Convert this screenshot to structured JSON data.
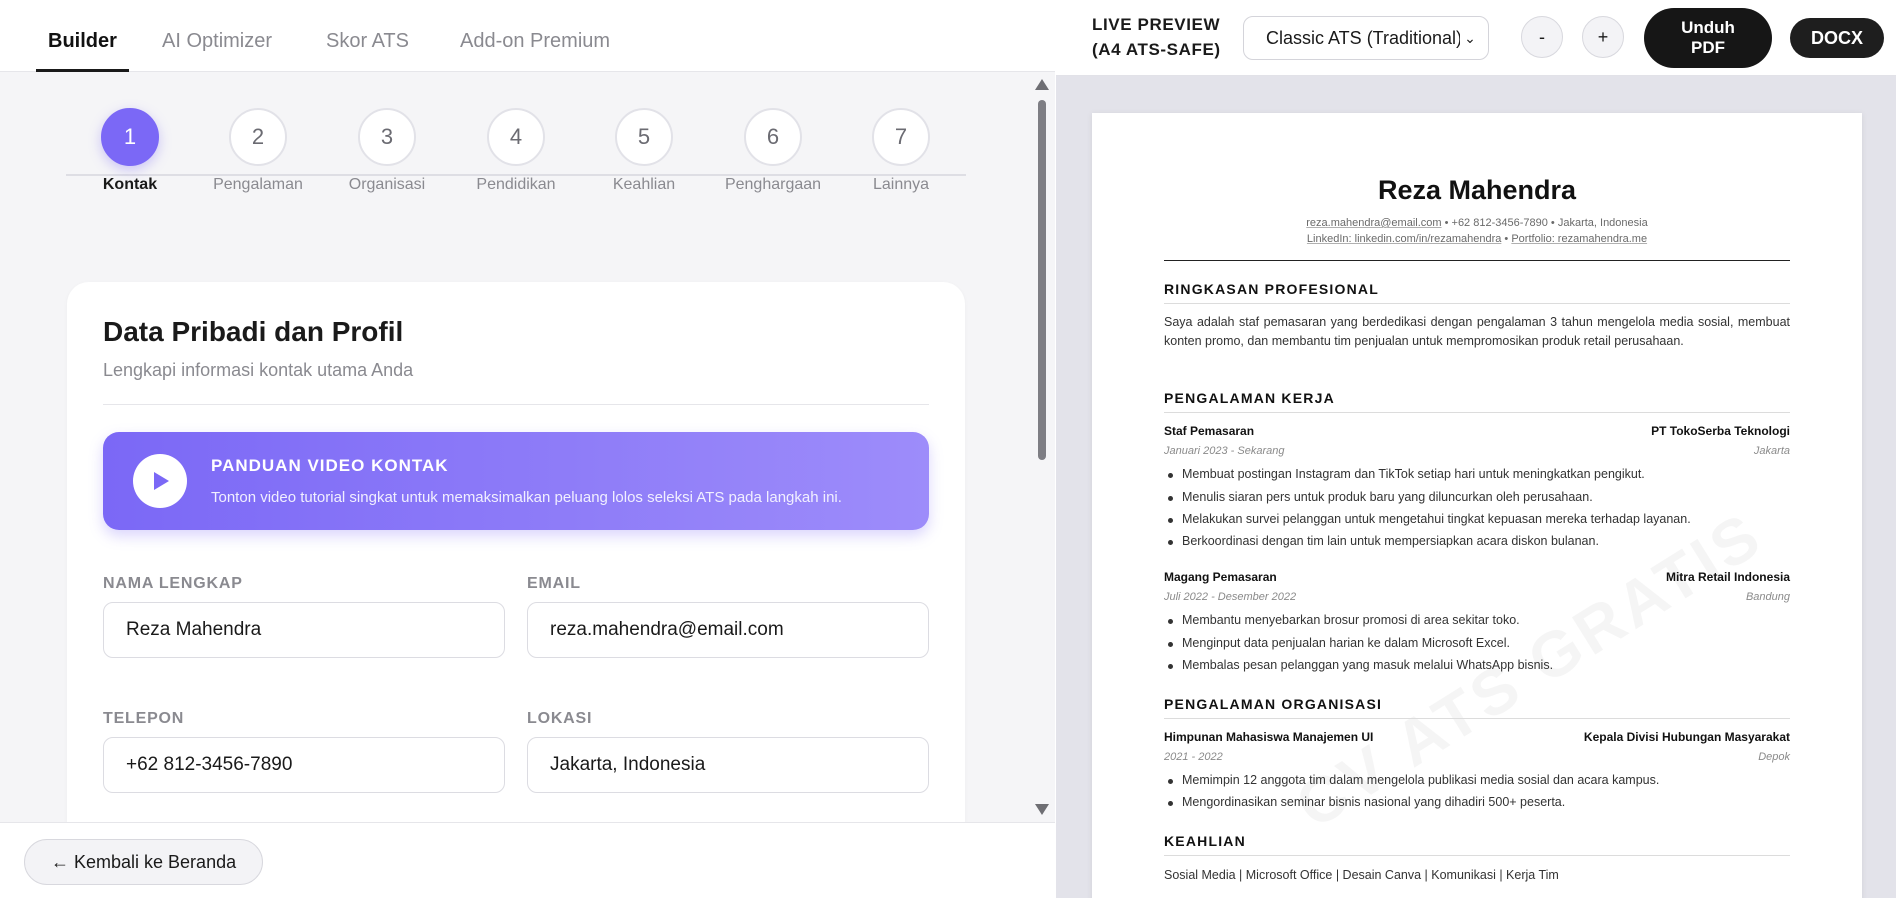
{
  "tabs": [
    {
      "label": "Builder"
    },
    {
      "label": "AI Optimizer"
    },
    {
      "label": "Skor ATS"
    },
    {
      "label": "Add-on Premium"
    }
  ],
  "steps": [
    {
      "num": "1",
      "label": "Kontak"
    },
    {
      "num": "2",
      "label": "Pengalaman"
    },
    {
      "num": "3",
      "label": "Organisasi"
    },
    {
      "num": "4",
      "label": "Pendidikan"
    },
    {
      "num": "5",
      "label": "Keahlian"
    },
    {
      "num": "6",
      "label": "Penghargaan"
    },
    {
      "num": "7",
      "label": "Lainnya"
    }
  ],
  "form": {
    "title": "Data Pribadi dan Profil",
    "subtitle": "Lengkapi informasi kontak utama Anda",
    "video": {
      "title": "PANDUAN VIDEO KONTAK",
      "desc": "Tonton video tutorial singkat untuk memaksimalkan peluang lolos seleksi ATS pada langkah ini."
    },
    "fields": {
      "name": {
        "label": "NAMA LENGKAP",
        "value": "Reza Mahendra"
      },
      "email": {
        "label": "EMAIL",
        "value": "reza.mahendra@email.com"
      },
      "phone": {
        "label": "TELEPON",
        "value": "+62 812-3456-7890"
      },
      "location": {
        "label": "LOKASI",
        "value": "Jakarta, Indonesia"
      }
    }
  },
  "footer": {
    "back_label": "← Kembali ke Beranda"
  },
  "preview": {
    "label_line1": "LIVE PREVIEW",
    "label_line2": "(A4 ATS-SAFE)",
    "template": "Classic ATS (Traditional)",
    "zoom_out": "-",
    "zoom_in": "+",
    "pdf_line1": "Unduh",
    "pdf_line2": "PDF",
    "docx": "DOCX"
  },
  "cv": {
    "watermark": "CV ATS GRATIS",
    "name": "Reza Mahendra",
    "email": "reza.mahendra@email.com",
    "phone": "+62 812-3456-7890",
    "location": "Jakarta, Indonesia",
    "sep": " • ",
    "linkedin": "LinkedIn: linkedin.com/in/rezamahendra",
    "portfolio": "Portfolio: rezamahendra.me",
    "summary_title": "RINGKASAN PROFESIONAL",
    "summary": "Saya adalah staf pemasaran yang berdedikasi dengan pengalaman 3 tahun mengelola media sosial, membuat konten promo, dan membantu tim penjualan untuk mempromosikan produk retail perusahaan.",
    "exp_title": "PENGALAMAN KERJA",
    "exp": [
      {
        "role": "Staf Pemasaran",
        "company": "PT TokoSerba Teknologi",
        "period": "Januari 2023 - Sekarang",
        "place": "Jakarta",
        "bullets": [
          "Membuat postingan Instagram dan TikTok setiap hari untuk meningkatkan pengikut.",
          "Menulis siaran pers untuk produk baru yang diluncurkan oleh perusahaan.",
          "Melakukan survei pelanggan untuk mengetahui tingkat kepuasan mereka terhadap layanan.",
          "Berkoordinasi dengan tim lain untuk mempersiapkan acara diskon bulanan."
        ]
      },
      {
        "role": "Magang Pemasaran",
        "company": "Mitra Retail Indonesia",
        "period": "Juli 2022 - Desember 2022",
        "place": "Bandung",
        "bullets": [
          "Membantu menyebarkan brosur promosi di area sekitar toko.",
          "Menginput data penjualan harian ke dalam Microsoft Excel.",
          "Membalas pesan pelanggan yang masuk melalui WhatsApp bisnis."
        ]
      }
    ],
    "org_title": "PENGALAMAN ORGANISASI",
    "org": {
      "name": "Himpunan Mahasiswa Manajemen UI",
      "role": "Kepala Divisi Hubungan Masyarakat",
      "period": "2021 - 2022",
      "place": "Depok",
      "bullets": [
        "Memimpin 12 anggota tim dalam mengelola publikasi media sosial dan acara kampus.",
        "Mengordinasikan seminar bisnis nasional yang dihadiri 500+ peserta."
      ]
    },
    "skills_title": "KEAHLIAN",
    "skills": "Sosial Media | Microsoft Office | Desain Canva | Komunikasi | Kerja Tim"
  },
  "colors": {
    "accent": "#7b68f6",
    "dark_button": "#161616"
  }
}
